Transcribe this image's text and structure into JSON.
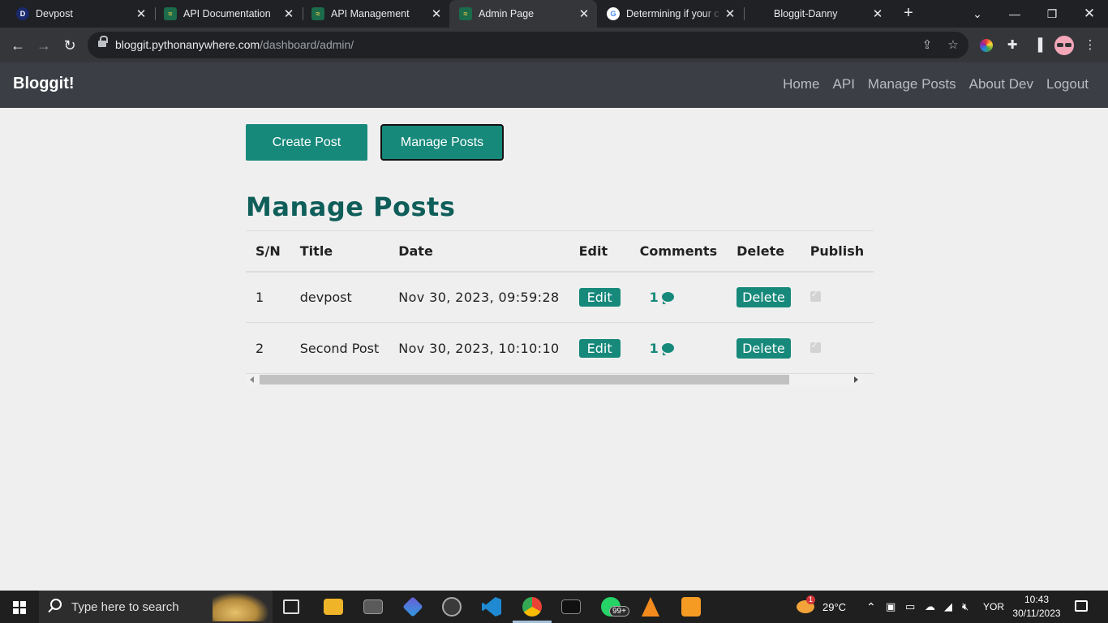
{
  "browser": {
    "tabs": [
      {
        "title": "Devpost",
        "favicon": "D"
      },
      {
        "title": "API Documentation",
        "favicon": "pa"
      },
      {
        "title": "API Management",
        "favicon": "pa"
      },
      {
        "title": "Admin Page",
        "favicon": "pa",
        "active": true
      },
      {
        "title": "Determining if your c",
        "favicon": "G"
      },
      {
        "title": "Bloggit-Danny",
        "favicon": ""
      }
    ],
    "url_host": "bloggit.pythonanywhere.com",
    "url_path": "/dashboard/admin/"
  },
  "site": {
    "brand": "Bloggit!",
    "nav": [
      "Home",
      "API",
      "Manage Posts",
      "About Dev",
      "Logout"
    ]
  },
  "actions": {
    "create_post": "Create Post",
    "manage_posts": "Manage Posts"
  },
  "page_title": "Manage Posts",
  "table": {
    "headers": [
      "S/N",
      "Title",
      "Date",
      "Edit",
      "Comments",
      "Delete",
      "Publish"
    ],
    "rows": [
      {
        "sn": "1",
        "title": "devpost",
        "date": "Nov 30, 2023, 09:59:28",
        "edit": "Edit",
        "comments": "1",
        "delete": "Delete",
        "published": true
      },
      {
        "sn": "2",
        "title": "Second Post",
        "date": "Nov 30, 2023, 10:10:10",
        "edit": "Edit",
        "comments": "1",
        "delete": "Delete",
        "published": true
      }
    ]
  },
  "taskbar": {
    "search_placeholder": "Type here to search",
    "weather": "29°C",
    "weather_badge": "1",
    "whatsapp_badge": "99+",
    "language": "YOR",
    "time": "10:43",
    "date": "30/11/2023"
  },
  "colors": {
    "accent": "#17897b",
    "heading": "#0f5e5a",
    "navbar": "#3b3f45"
  }
}
